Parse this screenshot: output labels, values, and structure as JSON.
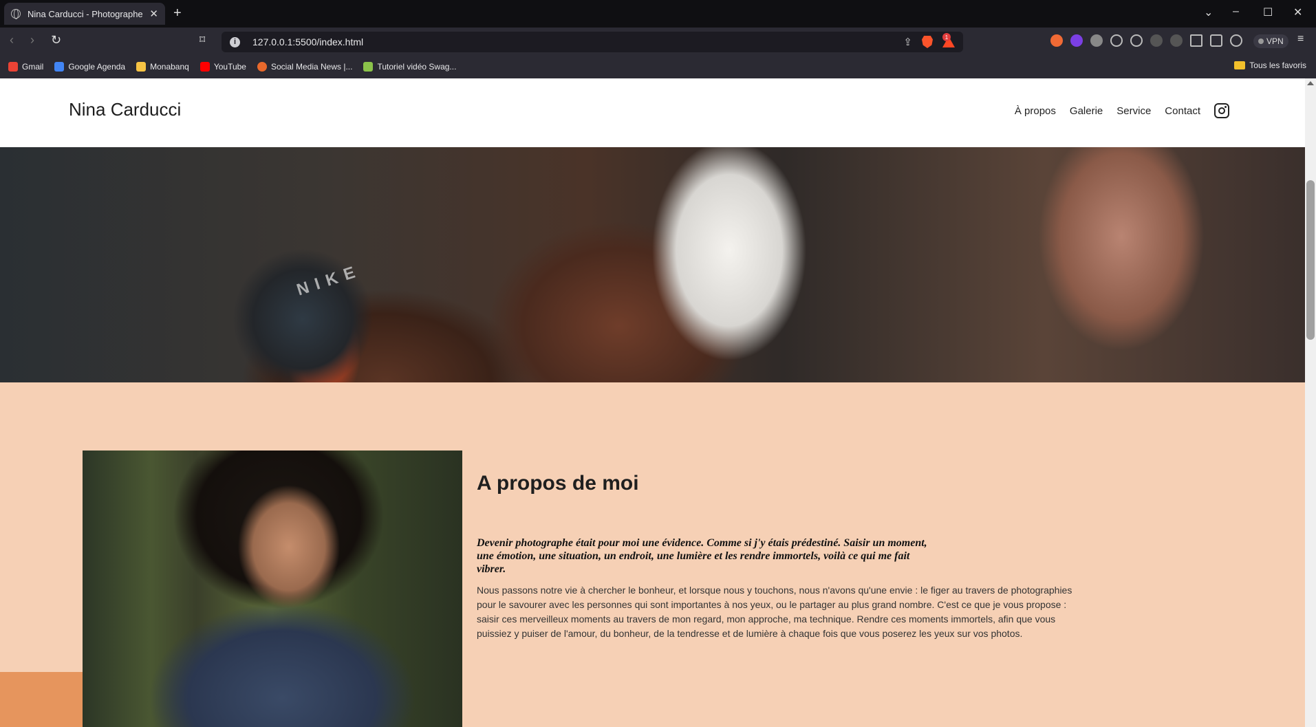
{
  "browser": {
    "tab_title": "Nina Carducci - Photographe",
    "new_tab_symbol": "+",
    "url": "127.0.0.1:5500/index.html",
    "vpn_label": "VPN",
    "rewards_badge": "1",
    "bookmarks": [
      {
        "label": "Gmail",
        "color": "#ea4335"
      },
      {
        "label": "Google Agenda",
        "color": "#4285f4"
      },
      {
        "label": "Monabanq",
        "color": "#f6c344"
      },
      {
        "label": "YouTube",
        "color": "#ff0000"
      },
      {
        "label": "Social Media News |...",
        "color": "#e9692c"
      },
      {
        "label": "Tutoriel vidéo Swag...",
        "color": "#8bc34a"
      }
    ],
    "all_bookmarks": "Tous les favoris"
  },
  "site": {
    "brand": "Nina Carducci",
    "nav": [
      "À propos",
      "Galerie",
      "Service",
      "Contact"
    ],
    "colors": {
      "background": "#f6d0b5",
      "accent": "#e6955d",
      "header": "#ffffff"
    },
    "carousel": {
      "slides": 3,
      "active": 2
    },
    "about": {
      "title": "A propos de moi",
      "lead": "Devenir photographe était pour moi une évidence. Comme si j'y étais prédestiné. Saisir un moment, une émotion, une situation, un endroit, une lumière et les rendre immortels, voilà ce qui me fait vibrer.",
      "body": "Nous passons notre vie à chercher le bonheur, et lorsque nous y touchons, nous n'avons qu'une envie : le figer au travers de photographies pour le savourer avec les personnes qui sont importantes à nos yeux, ou le partager au plus grand nombre. C'est ce que je vous propose : saisir ces merveilleux moments au travers de mon regard, mon approche, ma technique. Rendre ces moments immortels, afin que vous puissiez y puiser de l'amour, du bonheur, de la tendresse et de lumière à chaque fois que vous poserez les yeux sur vos photos."
    }
  }
}
